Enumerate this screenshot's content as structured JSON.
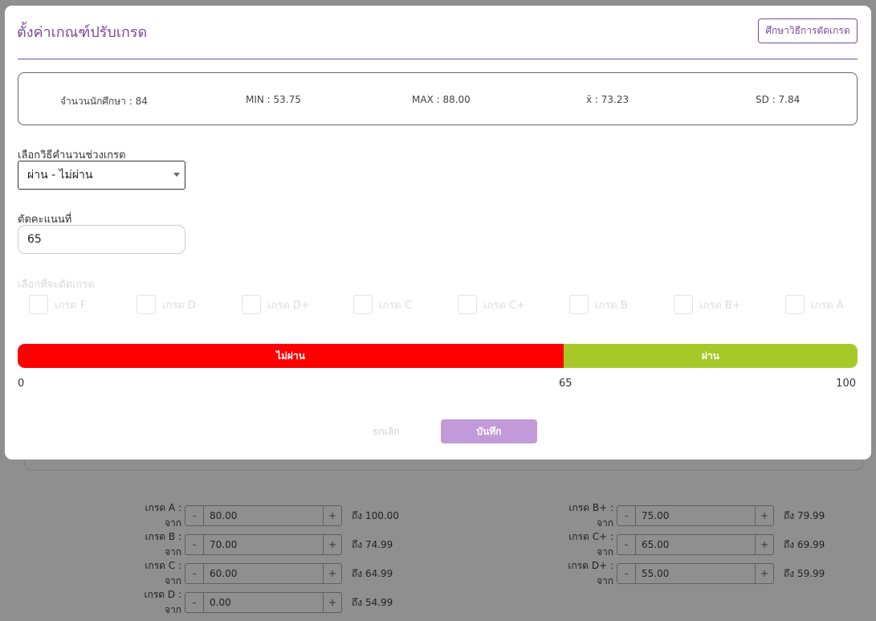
{
  "modal": {
    "title": "ตั้งค่าเกณฑ์ปรับเกรด",
    "study_button": "ศึกษาวิธีการตัดเกรด",
    "stats": {
      "students": "จำนวนนักศึกษา : 84",
      "min": "MIN : 53.75",
      "max": "MAX : 88.00",
      "mean": "x̄ : 73.23",
      "sd": "SD : 7.84"
    },
    "method_label": "เลือกวิธีคำนวนช่วงเกรด",
    "method_value": "ผ่าน - ไม่ผ่าน",
    "cut_label": "ตัดคะแนนที่",
    "cut_value": "65",
    "grade_select_label": "เลือกที่จะตัดเกรด",
    "grade_options": [
      "เกรด F",
      "เกรด D",
      "เกรด D+",
      "เกรด C",
      "เกรด C+",
      "เกรด B",
      "เกรด B+",
      "เกรด A"
    ],
    "bar": {
      "fail_label": "ไม่ผ่าน",
      "pass_label": "ผ่าน",
      "fail_color": "#ff0000",
      "pass_color": "#a8c82a",
      "cut_fraction": 0.65
    },
    "scale": {
      "min": "0",
      "cut": "65",
      "max": "100"
    },
    "cancel_label": "ยกเลิก",
    "save_label": "บันทึก"
  },
  "background": {
    "grades": [
      {
        "label": "เกรด A : จาก",
        "value": "80.00",
        "to": "ถึง 100.00"
      },
      {
        "label": "เกรด B+ : จาก",
        "value": "75.00",
        "to": "ถึง 79.99"
      },
      {
        "label": "เกรด B : จาก",
        "value": "70.00",
        "to": "ถึง 74.99"
      },
      {
        "label": "เกรด C+ : จาก",
        "value": "65.00",
        "to": "ถึง 69.99"
      },
      {
        "label": "เกรด C : จาก",
        "value": "60.00",
        "to": "ถึง 64.99"
      },
      {
        "label": "เกรด D+ : จาก",
        "value": "55.00",
        "to": "ถึง 59.99"
      },
      {
        "label": "เกรด D : จาก",
        "value": "0.00",
        "to": "ถึง 54.99"
      }
    ],
    "minus": "-",
    "plus": "+"
  },
  "colors": {
    "accent": "#7b4a9e",
    "overlay": "#8f8f8f"
  }
}
